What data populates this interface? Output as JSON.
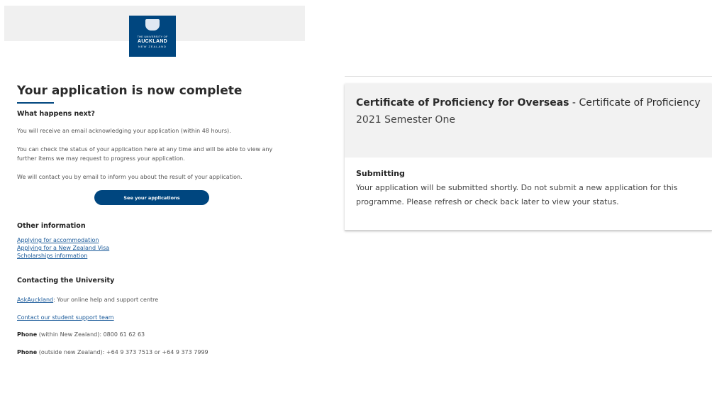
{
  "logo": {
    "line1": "THE UNIVERSITY OF",
    "line2": "AUCKLAND",
    "line3": "NEW ZEALAND"
  },
  "confirmation": {
    "title": "Your application is now complete",
    "next_heading": "What happens next?",
    "para1": "You will receive an email acknowledging your application (within 48 hours).",
    "para2": "You can check the status of your application here at any time and will be able to view any further items we may request to progress your application.",
    "para3": "We will contact you by email to inform you about the result of your application.",
    "button_label": "See your applications"
  },
  "other_info": {
    "heading": "Other information",
    "links": [
      "Applying for accommodation",
      "Applying for a New Zealand Visa",
      "Scholarships information"
    ]
  },
  "contact": {
    "heading": "Contacting the University",
    "ask_link": "AskAuckland",
    "ask_text": ": Your online help and support centre",
    "support_link": "Contact our student support team",
    "phone_label": "Phone",
    "phone_nz": " (within New Zealand): 0800 61 62 63",
    "phone_intl": " (outside new Zealand): +64 9 373 7513 or +64 9 373 7999"
  },
  "application_card": {
    "programme": "Certificate of Proficiency for Overseas",
    "separator": " - ",
    "qualification": "Certificate of Proficiency",
    "semester": "2021 Semester One",
    "status_label": "Submitting",
    "status_message": "Your application will be submitted shortly. Do not submit a new application for this programme. Please refresh or check back later to view your status."
  },
  "colors": {
    "brand": "#00467f",
    "link": "#1a5a9a",
    "header_band": "#f0f0f0"
  }
}
